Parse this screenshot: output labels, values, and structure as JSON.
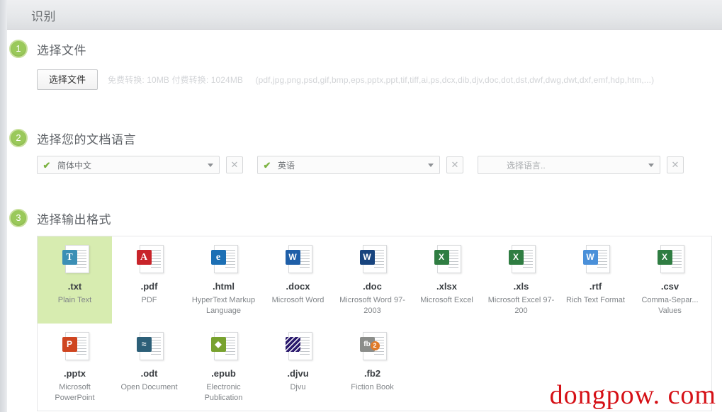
{
  "header": {
    "title": "识别"
  },
  "watermark": {
    "text": "dongpow. com"
  },
  "steps": {
    "one": {
      "number": "1",
      "title": "选择文件",
      "choose_button": "选择文件",
      "limits": "免费转换: 10MB  付费转换: 1024MB",
      "formats": "(pdf,jpg,png,psd,gif,bmp,eps,pptx,ppt,tif,tiff,ai,ps,dcx,dib,djv,doc,dot,dst,dwf,dwg,dwt,dxf,emf,hdp,htm,...)"
    },
    "two": {
      "number": "2",
      "title": "选择您的文档语言",
      "clear_label": "✕",
      "selects": [
        {
          "value": "简体中文",
          "checked": true,
          "check": "✔"
        },
        {
          "value": "英语",
          "checked": true,
          "check": "✔"
        },
        {
          "value": "选择语言..",
          "checked": false,
          "check": "✔"
        }
      ]
    },
    "three": {
      "number": "3",
      "title": "选择输出格式",
      "formats": [
        {
          "ext": ".txt",
          "desc": "Plain Text",
          "badge": "T",
          "badge_color": "#3b8fb5",
          "selected": true,
          "style": "serif"
        },
        {
          "ext": ".pdf",
          "desc": "PDF",
          "badge": "A",
          "badge_color": "#c8242a",
          "selected": false,
          "style": "serif"
        },
        {
          "ext": ".html",
          "desc": "HyperText Markup Language",
          "badge": "e",
          "badge_color": "#1c6fb4",
          "selected": false,
          "style": "serif"
        },
        {
          "ext": ".docx",
          "desc": "Microsoft Word",
          "badge": "W",
          "badge_color": "#1f5fa8",
          "selected": false,
          "style": "plain"
        },
        {
          "ext": ".doc",
          "desc": "Microsoft Word 97-2003",
          "badge": "W",
          "badge_color": "#18447e",
          "selected": false,
          "style": "plain"
        },
        {
          "ext": ".xlsx",
          "desc": "Microsoft Excel",
          "badge": "X",
          "badge_color": "#2f7d42",
          "selected": false,
          "style": "plain"
        },
        {
          "ext": ".xls",
          "desc": "Microsoft Excel 97-200",
          "badge": "X",
          "badge_color": "#2f7d42",
          "selected": false,
          "style": "plain"
        },
        {
          "ext": ".rtf",
          "desc": "Rich Text Format",
          "badge": "W",
          "badge_color": "#4a90d9",
          "selected": false,
          "style": "plain"
        },
        {
          "ext": ".csv",
          "desc": "Comma-Separ... Values",
          "badge": "X",
          "badge_color": "#2f7d42",
          "selected": false,
          "style": "plain"
        },
        {
          "ext": ".pptx",
          "desc": "Microsoft PowerPoint",
          "badge": "P",
          "badge_color": "#cf4520",
          "selected": false,
          "style": "plain"
        },
        {
          "ext": ".odt",
          "desc": "Open Document",
          "badge": "≈",
          "badge_color": "#2c5f78",
          "selected": false,
          "style": "plain"
        },
        {
          "ext": ".epub",
          "desc": "Electronic Publication",
          "badge": "◆",
          "badge_color": "#78a22f",
          "selected": false,
          "style": "plain"
        },
        {
          "ext": ".djvu",
          "desc": "Djvu",
          "badge": "",
          "badge_color": "#2b1a6e",
          "selected": false,
          "style": "djvu"
        },
        {
          "ext": ".fb2",
          "desc": "Fiction Book",
          "badge": "fb",
          "badge_color": "#8b8d8a",
          "selected": false,
          "style": "fb2",
          "dot": "2"
        }
      ]
    }
  }
}
